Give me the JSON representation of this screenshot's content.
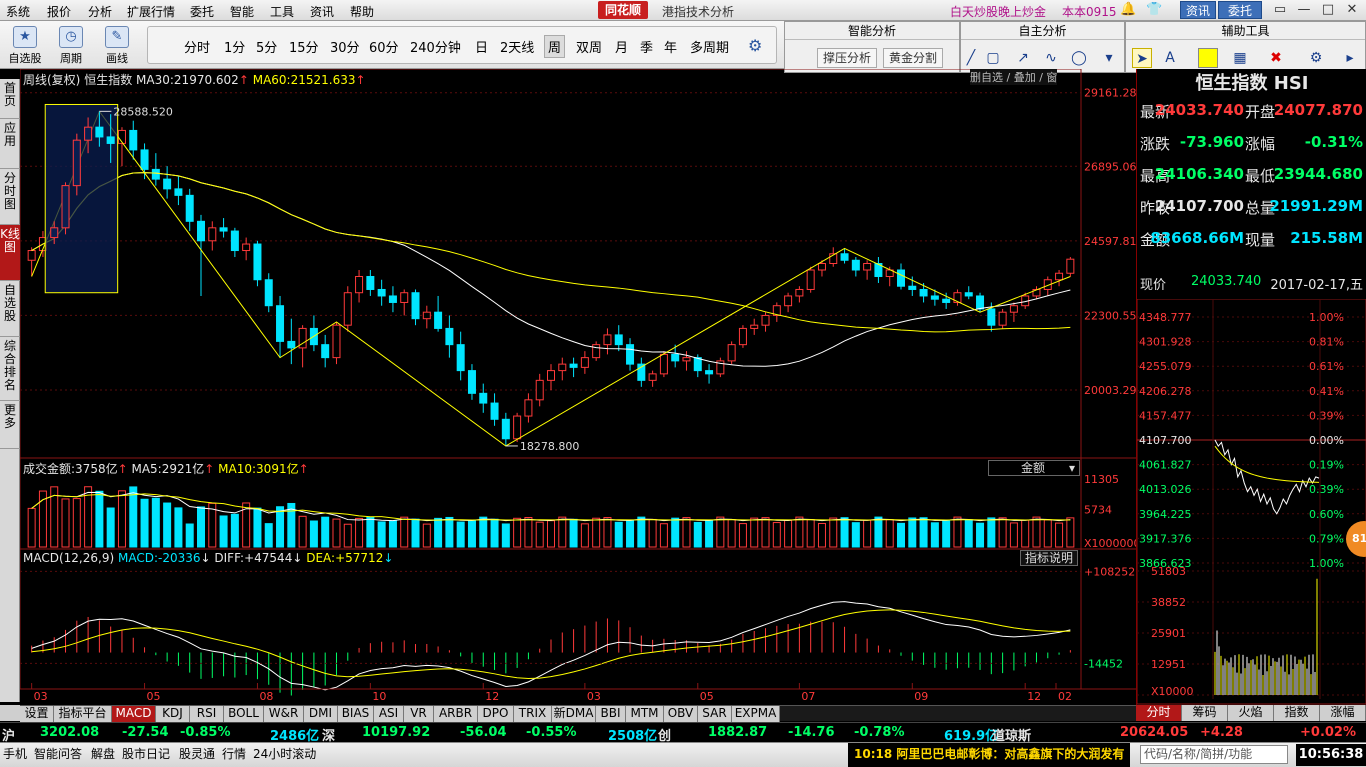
{
  "menu": {
    "items": [
      "系统",
      "报价",
      "分析",
      "扩展行情",
      "委托",
      "智能",
      "工具",
      "资讯",
      "帮助"
    ],
    "logo": "同花顺",
    "window_title": "港指技术分析",
    "promo": "白天炒股晚上炒金",
    "version": "本本0915",
    "btn_news": "资讯",
    "btn_trade": "委托"
  },
  "toolbar": {
    "self_select": "自选股",
    "cycle": "周期",
    "draw": "画线",
    "periods": [
      "分时",
      "1分",
      "5分",
      "15分",
      "30分",
      "60分",
      "240分钟",
      "日",
      "2天线",
      "周",
      "双周",
      "月",
      "季",
      "年",
      "多周期"
    ],
    "active_period": "周"
  },
  "panels": {
    "smart_title": "智能分析",
    "smart_btn1": "撑压分析",
    "smart_btn2": "黄金分割",
    "self_title": "自主分析",
    "aux_title": "辅助工具"
  },
  "left_tabs": [
    "首页",
    "应用",
    "分时图",
    "K线图",
    "自选股",
    "综合排名",
    "更多"
  ],
  "chart": {
    "period_label": "周线(复权)",
    "index_name": "恒生指数",
    "ma30_label": "MA30:",
    "ma30_value": "21970.602",
    "ma60_label": "MA60:",
    "ma60_value": "21521.633",
    "ctrl_text": "删自选 / 叠加 / 窗",
    "high_mark": "28588.520",
    "low_mark": "18278.800",
    "price_ticks": [
      "29161.28",
      "26895.06",
      "24597.81",
      "22300.55",
      "20003.29"
    ],
    "vol_label": "成交金额:",
    "vol_value": "3758亿",
    "vol_ma5_label": "MA5:",
    "vol_ma5_value": "2921亿",
    "vol_ma10_label": "MA10:",
    "vol_ma10_value": "3091亿",
    "vol_select": "金额",
    "vol_ticks": [
      "11305",
      "5734",
      "X100000000"
    ],
    "macd_label": "MACD(12,26,9)",
    "macd_title": "MACD:",
    "macd_value": "-20336",
    "diff_title": "DIFF:",
    "diff_value": "+47544",
    "dea_title": "DEA:",
    "dea_value": "+57712",
    "macd_ticks": [
      "+108252",
      "-14452"
    ],
    "ind_note": "指标说明",
    "x_ticks": [
      "03",
      "05",
      "08",
      "10",
      "12",
      "03",
      "05",
      "07",
      "09",
      "12",
      "02"
    ]
  },
  "chart_data": {
    "type": "candlestick",
    "title": "恒生指数 周线(复权)",
    "ylim": [
      18000,
      29400
    ],
    "high": 28588.52,
    "low": 18278.8,
    "ma30": 21970.602,
    "ma60": 21521.633,
    "x_ticks": [
      "03",
      "05",
      "08",
      "10",
      "12",
      "03",
      "05",
      "07",
      "09",
      "12",
      "02"
    ],
    "ohlc": [
      [
        24000,
        24400,
        23500,
        24300
      ],
      [
        24300,
        24900,
        24100,
        24700
      ],
      [
        24700,
        25200,
        24500,
        25000
      ],
      [
        25000,
        26400,
        24800,
        26300
      ],
      [
        26300,
        27900,
        26000,
        27700
      ],
      [
        27700,
        28400,
        27300,
        28100
      ],
      [
        28100,
        28588,
        27500,
        27800
      ],
      [
        27800,
        28500,
        27000,
        27600
      ],
      [
        27600,
        28100,
        26900,
        28000
      ],
      [
        28000,
        28300,
        27100,
        27400
      ],
      [
        27400,
        27600,
        26500,
        26800
      ],
      [
        26800,
        27300,
        26300,
        26500
      ],
      [
        26500,
        26900,
        25900,
        26200
      ],
      [
        26200,
        26600,
        25700,
        26000
      ],
      [
        26000,
        26200,
        24900,
        25200
      ],
      [
        25200,
        25400,
        22900,
        24600
      ],
      [
        24600,
        25200,
        24300,
        25000
      ],
      [
        25000,
        25300,
        24700,
        24900
      ],
      [
        24900,
        25000,
        24100,
        24300
      ],
      [
        24300,
        24700,
        24000,
        24500
      ],
      [
        24500,
        24600,
        23200,
        23400
      ],
      [
        23400,
        23600,
        22400,
        22600
      ],
      [
        22600,
        22900,
        21000,
        21500
      ],
      [
        21500,
        22200,
        20800,
        21300
      ],
      [
        21300,
        22000,
        20700,
        21900
      ],
      [
        21900,
        22300,
        21200,
        21400
      ],
      [
        21400,
        21700,
        20700,
        21000
      ],
      [
        21000,
        22100,
        20800,
        22000
      ],
      [
        22000,
        23200,
        21800,
        23000
      ],
      [
        23000,
        23700,
        22700,
        23500
      ],
      [
        23500,
        23700,
        22900,
        23100
      ],
      [
        23100,
        23400,
        22600,
        22900
      ],
      [
        22900,
        23200,
        22400,
        22700
      ],
      [
        22700,
        23100,
        22300,
        23000
      ],
      [
        23000,
        23100,
        22000,
        22200
      ],
      [
        22200,
        22600,
        21900,
        22400
      ],
      [
        22400,
        22900,
        21800,
        21900
      ],
      [
        21900,
        22300,
        21000,
        21400
      ],
      [
        21400,
        21800,
        20300,
        20600
      ],
      [
        20600,
        20800,
        19700,
        19900
      ],
      [
        19900,
        20200,
        19300,
        19600
      ],
      [
        19600,
        19900,
        18900,
        19100
      ],
      [
        19100,
        19300,
        18278,
        18500
      ],
      [
        18500,
        19300,
        18400,
        19200
      ],
      [
        19200,
        19900,
        19000,
        19700
      ],
      [
        19700,
        20500,
        19500,
        20300
      ],
      [
        20300,
        20800,
        20000,
        20600
      ],
      [
        20600,
        21000,
        20300,
        20800
      ],
      [
        20800,
        21000,
        20400,
        20700
      ],
      [
        20700,
        21200,
        20500,
        21000
      ],
      [
        21000,
        21500,
        20900,
        21400
      ],
      [
        21400,
        21900,
        21100,
        21700
      ],
      [
        21700,
        22000,
        21200,
        21400
      ],
      [
        21400,
        21600,
        20600,
        20800
      ],
      [
        20800,
        21000,
        20100,
        20300
      ],
      [
        20300,
        20600,
        20100,
        20500
      ],
      [
        20500,
        21200,
        20400,
        21100
      ],
      [
        21100,
        21400,
        20700,
        20900
      ],
      [
        20900,
        21200,
        20600,
        21000
      ],
      [
        21000,
        21100,
        20400,
        20600
      ],
      [
        20600,
        20800,
        20200,
        20500
      ],
      [
        20500,
        21000,
        20400,
        20900
      ],
      [
        20900,
        21500,
        20800,
        21400
      ],
      [
        21400,
        22000,
        21300,
        21900
      ],
      [
        21900,
        22200,
        21700,
        22000
      ],
      [
        22000,
        22400,
        21800,
        22300
      ],
      [
        22300,
        22700,
        22100,
        22600
      ],
      [
        22600,
        23000,
        22400,
        22900
      ],
      [
        22900,
        23200,
        22700,
        23100
      ],
      [
        23100,
        23800,
        23000,
        23700
      ],
      [
        23700,
        24000,
        23500,
        23900
      ],
      [
        23900,
        24400,
        23800,
        24200
      ],
      [
        24200,
        24364,
        23900,
        24000
      ],
      [
        24000,
        24100,
        23500,
        23700
      ],
      [
        23700,
        24000,
        23400,
        23900
      ],
      [
        23900,
        24100,
        23300,
        23500
      ],
      [
        23500,
        23800,
        23200,
        23700
      ],
      [
        23700,
        23900,
        23100,
        23200
      ],
      [
        23200,
        23500,
        22900,
        23100
      ],
      [
        23100,
        23300,
        22700,
        22900
      ],
      [
        22900,
        23100,
        22600,
        22800
      ],
      [
        22800,
        23000,
        22500,
        22700
      ],
      [
        22700,
        23100,
        22600,
        23000
      ],
      [
        23000,
        23200,
        22800,
        22900
      ],
      [
        22900,
        23000,
        22400,
        22500
      ],
      [
        22500,
        22700,
        21800,
        22000
      ],
      [
        22000,
        22500,
        21900,
        22400
      ],
      [
        22400,
        22700,
        22100,
        22600
      ],
      [
        22600,
        23000,
        22500,
        22900
      ],
      [
        22900,
        23200,
        22800,
        23100
      ],
      [
        23100,
        23500,
        22900,
        23400
      ],
      [
        23400,
        23700,
        23200,
        23600
      ],
      [
        23600,
        24100,
        23500,
        24033
      ]
    ],
    "volume_ylim": [
      0,
      11305
    ],
    "macd_ylim": [
      -14452,
      108252
    ]
  },
  "quote": {
    "title": "恒生指数 HSI",
    "rows": [
      {
        "l1": "最新",
        "v1": "24033.740",
        "c1": "#ff3a3a",
        "l2": "开盘",
        "v2": "24077.870",
        "c2": "#ff3a3a"
      },
      {
        "l1": "涨跌",
        "v1": "-73.960",
        "c1": "#00ff66",
        "l2": "涨幅",
        "v2": "-0.31%",
        "c2": "#00ff66"
      },
      {
        "l1": "最高",
        "v1": "24106.340",
        "c1": "#00ff66",
        "l2": "最低",
        "v2": "23944.680",
        "c2": "#00ff66"
      },
      {
        "l1": "昨收",
        "v1": "24107.700",
        "c1": "#e6e6e6",
        "l2": "总量",
        "v2": "21991.29M",
        "c2": "#00e5ff"
      },
      {
        "l1": "金额",
        "v1": "83668.66M",
        "c1": "#00e5ff",
        "l2": "现量",
        "v2": "215.58M",
        "c2": "#00e5ff"
      }
    ],
    "cur_label": "现价",
    "cur_value": "24033.740",
    "date": "2017-02-17,五"
  },
  "mini": {
    "left_ticks": [
      "4348.777",
      "4301.928",
      "4255.079",
      "4206.278",
      "4157.477",
      "4107.700",
      "4061.827",
      "4013.026",
      "3964.225",
      "3917.376",
      "3866.623"
    ],
    "right_ticks": [
      "1.00%",
      "0.81%",
      "0.61%",
      "0.41%",
      "0.39%",
      "0.00%",
      "0.19%",
      "0.39%",
      "0.60%",
      "0.79%",
      "1.00%"
    ],
    "vol_ticks": [
      "51803",
      "38852",
      "25901",
      "12951",
      "X10000"
    ],
    "badge": "81"
  },
  "mini_tabs": [
    "分时",
    "筹码",
    "火焰",
    "指数",
    "涨幅"
  ],
  "indicator_tabs": [
    "设置",
    "指标平台",
    "MACD",
    "KDJ",
    "RSI",
    "BOLL",
    "W&R",
    "DMI",
    "BIAS",
    "ASI",
    "VR",
    "ARBR",
    "DPO",
    "TRIX",
    "新DMA",
    "BBI",
    "MTM",
    "OBV",
    "SAR",
    "EXPMA"
  ],
  "status": {
    "sh_label": "沪",
    "sh_price": "3202.08",
    "sh_chg": "-27.54",
    "sh_pct": "-0.85%",
    "sh_amt": "2486亿",
    "sz_label": "深",
    "sz_price": "10197.92",
    "sz_chg": "-56.04",
    "sz_pct": "-0.55%",
    "sz_amt": "2508亿",
    "cy_label": "创",
    "cy_price": "1882.87",
    "cy_chg": "-14.76",
    "cy_pct": "-0.78%",
    "cy_amt": "619.9亿",
    "dj_label": "道琼斯",
    "dj_price": "20624.05",
    "dj_chg": "+4.28",
    "dj_pct": "+0.02%"
  },
  "bottom": {
    "items": [
      "手机",
      "智能问答",
      "解盘",
      "股市日记",
      "股灵通",
      "行情",
      "24小时滚动"
    ],
    "ticker": "10:18 阿里巴巴电邮彰博：对高鑫旗下的大润发有",
    "search_placeholder": "代码/名称/简拼/功能",
    "clock": "10:56:38"
  }
}
